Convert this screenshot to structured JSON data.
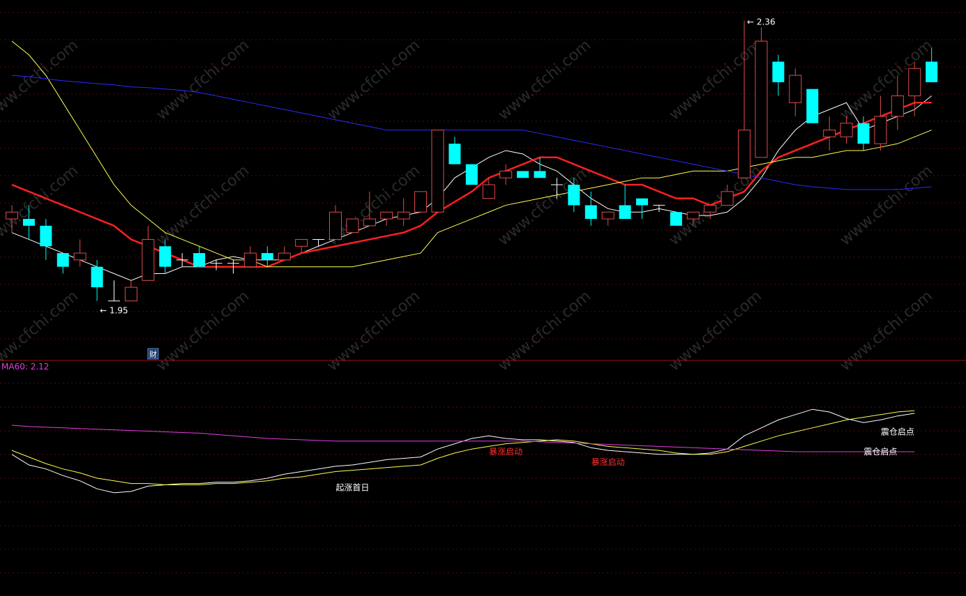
{
  "chart_data": [
    {
      "type": "candlestick",
      "title": "",
      "xlabel": "",
      "ylabel": "",
      "ylim": [
        1.86,
        2.38
      ],
      "colors": {
        "up": "#e04b4b",
        "down": "#00ffff",
        "doji": "#ffffff"
      },
      "candles": [
        {
          "o": 2.07,
          "h": 2.09,
          "l": 2.05,
          "c": 2.08
        },
        {
          "o": 2.07,
          "h": 2.09,
          "l": 2.04,
          "c": 2.06
        },
        {
          "o": 2.06,
          "h": 2.07,
          "l": 2.01,
          "c": 2.03
        },
        {
          "o": 2.02,
          "h": 2.02,
          "l": 1.99,
          "c": 2.0
        },
        {
          "o": 2.01,
          "h": 2.04,
          "l": 2.0,
          "c": 2.02
        },
        {
          "o": 2.0,
          "h": 2.01,
          "l": 1.95,
          "c": 1.97
        },
        {
          "o": 1.95,
          "h": 1.98,
          "l": 1.95,
          "c": 1.95
        },
        {
          "o": 1.95,
          "h": 1.98,
          "l": 1.95,
          "c": 1.97
        },
        {
          "o": 1.98,
          "h": 2.06,
          "l": 1.98,
          "c": 2.04
        },
        {
          "o": 2.03,
          "h": 2.04,
          "l": 1.99,
          "c": 2.0
        },
        {
          "o": 2.01,
          "h": 2.02,
          "l": 2.0,
          "c": 2.01
        },
        {
          "o": 2.02,
          "h": 2.03,
          "l": 2.0,
          "c": 2.0
        },
        {
          "o": 2.005,
          "h": 2.01,
          "l": 1.995,
          "c": 2.005
        },
        {
          "o": 2.005,
          "h": 2.01,
          "l": 1.99,
          "c": 2.005
        },
        {
          "o": 2.0,
          "h": 2.03,
          "l": 2.0,
          "c": 2.02
        },
        {
          "o": 2.02,
          "h": 2.03,
          "l": 2.0,
          "c": 2.01
        },
        {
          "o": 2.01,
          "h": 2.03,
          "l": 2.01,
          "c": 2.02
        },
        {
          "o": 2.03,
          "h": 2.04,
          "l": 2.02,
          "c": 2.04
        },
        {
          "o": 2.04,
          "h": 2.04,
          "l": 2.03,
          "c": 2.04
        },
        {
          "o": 2.04,
          "h": 2.09,
          "l": 2.04,
          "c": 2.08
        },
        {
          "o": 2.05,
          "h": 2.07,
          "l": 2.05,
          "c": 2.07
        },
        {
          "o": 2.06,
          "h": 2.11,
          "l": 2.06,
          "c": 2.07
        },
        {
          "o": 2.07,
          "h": 2.07,
          "l": 2.06,
          "c": 2.08
        },
        {
          "o": 2.07,
          "h": 2.1,
          "l": 2.06,
          "c": 2.08
        },
        {
          "o": 2.08,
          "h": 2.1,
          "l": 2.08,
          "c": 2.11
        },
        {
          "o": 2.08,
          "h": 2.2,
          "l": 2.08,
          "c": 2.2
        },
        {
          "o": 2.18,
          "h": 2.19,
          "l": 2.15,
          "c": 2.15
        },
        {
          "o": 2.15,
          "h": 2.15,
          "l": 2.12,
          "c": 2.12
        },
        {
          "o": 2.1,
          "h": 2.13,
          "l": 2.1,
          "c": 2.12
        },
        {
          "o": 2.13,
          "h": 2.15,
          "l": 2.12,
          "c": 2.14
        },
        {
          "o": 2.14,
          "h": 2.13,
          "l": 2.13,
          "c": 2.13
        },
        {
          "o": 2.14,
          "h": 2.16,
          "l": 2.13,
          "c": 2.13
        },
        {
          "o": 2.12,
          "h": 2.13,
          "l": 2.1,
          "c": 2.12
        },
        {
          "o": 2.12,
          "h": 2.13,
          "l": 2.08,
          "c": 2.09
        },
        {
          "o": 2.09,
          "h": 2.11,
          "l": 2.06,
          "c": 2.07
        },
        {
          "o": 2.07,
          "h": 2.08,
          "l": 2.06,
          "c": 2.08
        },
        {
          "o": 2.09,
          "h": 2.12,
          "l": 2.07,
          "c": 2.07
        },
        {
          "o": 2.1,
          "h": 2.1,
          "l": 2.07,
          "c": 2.09
        },
        {
          "o": 2.09,
          "h": 2.09,
          "l": 2.08,
          "c": 2.09
        },
        {
          "o": 2.08,
          "h": 2.08,
          "l": 2.06,
          "c": 2.06
        },
        {
          "o": 2.07,
          "h": 2.08,
          "l": 2.06,
          "c": 2.08
        },
        {
          "o": 2.08,
          "h": 2.09,
          "l": 2.07,
          "c": 2.09
        },
        {
          "o": 2.09,
          "h": 2.12,
          "l": 2.09,
          "c": 2.11
        },
        {
          "o": 2.13,
          "h": 2.36,
          "l": 2.13,
          "c": 2.2
        },
        {
          "o": 2.16,
          "h": 2.35,
          "l": 2.16,
          "c": 2.33
        },
        {
          "o": 2.3,
          "h": 2.31,
          "l": 2.25,
          "c": 2.27
        },
        {
          "o": 2.24,
          "h": 2.29,
          "l": 2.22,
          "c": 2.28
        },
        {
          "o": 2.26,
          "h": 2.26,
          "l": 2.21,
          "c": 2.21
        },
        {
          "o": 2.19,
          "h": 2.22,
          "l": 2.17,
          "c": 2.2
        },
        {
          "o": 2.19,
          "h": 2.22,
          "l": 2.18,
          "c": 2.21
        },
        {
          "o": 2.21,
          "h": 2.22,
          "l": 2.17,
          "c": 2.18
        },
        {
          "o": 2.18,
          "h": 2.25,
          "l": 2.17,
          "c": 2.22
        },
        {
          "o": 2.22,
          "h": 2.28,
          "l": 2.2,
          "c": 2.25
        },
        {
          "o": 2.25,
          "h": 2.3,
          "l": 2.22,
          "c": 2.29
        },
        {
          "o": 2.3,
          "h": 2.32,
          "l": 2.27,
          "c": 2.27
        }
      ],
      "moving_averages": [
        {
          "color": "#ffffff",
          "values": [
            2.05,
            2.04,
            2.03,
            2.02,
            2.01,
            2.0,
            1.99,
            1.98,
            1.99,
            1.99,
            2.0,
            2.0,
            2.01,
            2.015,
            2.01,
            2.01,
            2.01,
            2.02,
            2.03,
            2.04,
            2.05,
            2.06,
            2.07,
            2.075,
            2.08,
            2.1,
            2.13,
            2.145,
            2.16,
            2.17,
            2.165,
            2.15,
            2.14,
            2.12,
            2.1,
            2.085,
            2.08,
            2.08,
            2.085,
            2.08,
            2.075,
            2.075,
            2.08,
            2.1,
            2.13,
            2.17,
            2.2,
            2.22,
            2.23,
            2.24,
            2.2,
            2.21,
            2.22,
            2.23,
            2.25
          ]
        },
        {
          "color": "#ff2020",
          "values": [
            2.12,
            2.11,
            2.1,
            2.09,
            2.08,
            2.07,
            2.06,
            2.04,
            2.03,
            2.02,
            2.01,
            2.0,
            2.0,
            2.0,
            2.0,
            2.0,
            2.01,
            2.02,
            2.025,
            2.03,
            2.035,
            2.04,
            2.045,
            2.05,
            2.06,
            2.08,
            2.095,
            2.11,
            2.13,
            2.14,
            2.15,
            2.16,
            2.16,
            2.15,
            2.14,
            2.13,
            2.12,
            2.12,
            2.11,
            2.1,
            2.1,
            2.09,
            2.1,
            2.11,
            2.14,
            2.16,
            2.17,
            2.18,
            2.19,
            2.2,
            2.21,
            2.22,
            2.23,
            2.24,
            2.24
          ]
        },
        {
          "color": "#ffff50",
          "values": [
            2.33,
            2.31,
            2.28,
            2.24,
            2.2,
            2.16,
            2.12,
            2.09,
            2.07,
            2.05,
            2.04,
            2.03,
            2.02,
            2.01,
            2.01,
            2.0,
            2.0,
            2.0,
            2.0,
            2.0,
            2.0,
            2.005,
            2.01,
            2.015,
            2.02,
            2.05,
            2.06,
            2.07,
            2.08,
            2.09,
            2.095,
            2.1,
            2.105,
            2.11,
            2.115,
            2.12,
            2.125,
            2.13,
            2.13,
            2.135,
            2.14,
            2.14,
            2.14,
            2.145,
            2.15,
            2.155,
            2.16,
            2.16,
            2.165,
            2.17,
            2.17,
            2.175,
            2.18,
            2.19,
            2.2
          ]
        },
        {
          "color": "#2a2aff",
          "values": [
            2.28,
            2.278,
            2.275,
            2.272,
            2.27,
            2.268,
            2.266,
            2.263,
            2.262,
            2.26,
            2.258,
            2.255,
            2.25,
            2.245,
            2.24,
            2.235,
            2.23,
            2.225,
            2.22,
            2.215,
            2.21,
            2.205,
            2.2,
            2.2,
            2.2,
            2.2,
            2.2,
            2.2,
            2.2,
            2.2,
            2.2,
            2.195,
            2.19,
            2.185,
            2.18,
            2.175,
            2.17,
            2.165,
            2.16,
            2.155,
            2.15,
            2.145,
            2.14,
            2.135,
            2.13,
            2.125,
            2.12,
            2.117,
            2.115,
            2.113,
            2.113,
            2.113,
            2.113,
            2.115,
            2.117
          ]
        }
      ],
      "annotations": {
        "high": {
          "index": 43,
          "value": 2.36,
          "text": "2.36"
        },
        "low": {
          "index": 5,
          "value": 1.95,
          "text": "1.95"
        },
        "marker": {
          "index": 7,
          "text": "财"
        }
      }
    },
    {
      "type": "line",
      "title": "MA60: 2.12",
      "ylim": [
        0,
        1
      ],
      "series": [
        {
          "color": "#ffffff",
          "values": [
            0.78,
            0.7,
            0.67,
            0.62,
            0.58,
            0.52,
            0.49,
            0.5,
            0.54,
            0.55,
            0.56,
            0.56,
            0.57,
            0.57,
            0.58,
            0.6,
            0.63,
            0.65,
            0.67,
            0.69,
            0.7,
            0.72,
            0.74,
            0.75,
            0.76,
            0.82,
            0.86,
            0.9,
            0.92,
            0.9,
            0.89,
            0.89,
            0.88,
            0.87,
            0.83,
            0.81,
            0.8,
            0.79,
            0.78,
            0.78,
            0.78,
            0.79,
            0.82,
            0.92,
            0.98,
            1.04,
            1.08,
            1.12,
            1.1,
            1.05,
            1.02,
            1.04,
            1.07,
            1.09
          ]
        },
        {
          "color": "#ffff50",
          "values": [
            0.81,
            0.76,
            0.71,
            0.67,
            0.64,
            0.6,
            0.58,
            0.56,
            0.56,
            0.55,
            0.55,
            0.55,
            0.56,
            0.56,
            0.57,
            0.58,
            0.6,
            0.61,
            0.63,
            0.65,
            0.66,
            0.67,
            0.68,
            0.69,
            0.7,
            0.75,
            0.79,
            0.82,
            0.84,
            0.86,
            0.87,
            0.88,
            0.89,
            0.88,
            0.86,
            0.84,
            0.83,
            0.82,
            0.81,
            0.79,
            0.78,
            0.78,
            0.8,
            0.84,
            0.88,
            0.92,
            0.95,
            0.98,
            1.01,
            1.04,
            1.06,
            1.08,
            1.1,
            1.11
          ]
        },
        {
          "color": "#e040e0",
          "values": [
            1.0,
            0.99,
            0.985,
            0.98,
            0.975,
            0.97,
            0.965,
            0.96,
            0.955,
            0.95,
            0.945,
            0.94,
            0.93,
            0.92,
            0.91,
            0.9,
            0.895,
            0.89,
            0.885,
            0.88,
            0.88,
            0.88,
            0.88,
            0.88,
            0.88,
            0.88,
            0.88,
            0.88,
            0.88,
            0.88,
            0.88,
            0.875,
            0.87,
            0.865,
            0.86,
            0.855,
            0.85,
            0.845,
            0.84,
            0.835,
            0.83,
            0.825,
            0.82,
            0.815,
            0.81,
            0.805,
            0.8,
            0.8,
            0.8,
            0.8,
            0.8,
            0.8,
            0.8,
            0.8
          ]
        }
      ],
      "annotations": [
        {
          "text": "起涨首日",
          "color": "#ffffff",
          "index": 20,
          "value": 0.53
        },
        {
          "text": "暴涨启动",
          "color": "#ff3030",
          "index": 29,
          "value": 0.8
        },
        {
          "text": "暴涨启动",
          "color": "#ff3030",
          "index": 35,
          "value": 0.72
        },
        {
          "text": "震仓启点",
          "color": "#ffffff",
          "index": 52,
          "value": 0.95
        },
        {
          "text": "震仓启点",
          "color": "#ffffff",
          "index": 51,
          "value": 0.8
        }
      ]
    }
  ],
  "watermark": "www.cfchi.com"
}
